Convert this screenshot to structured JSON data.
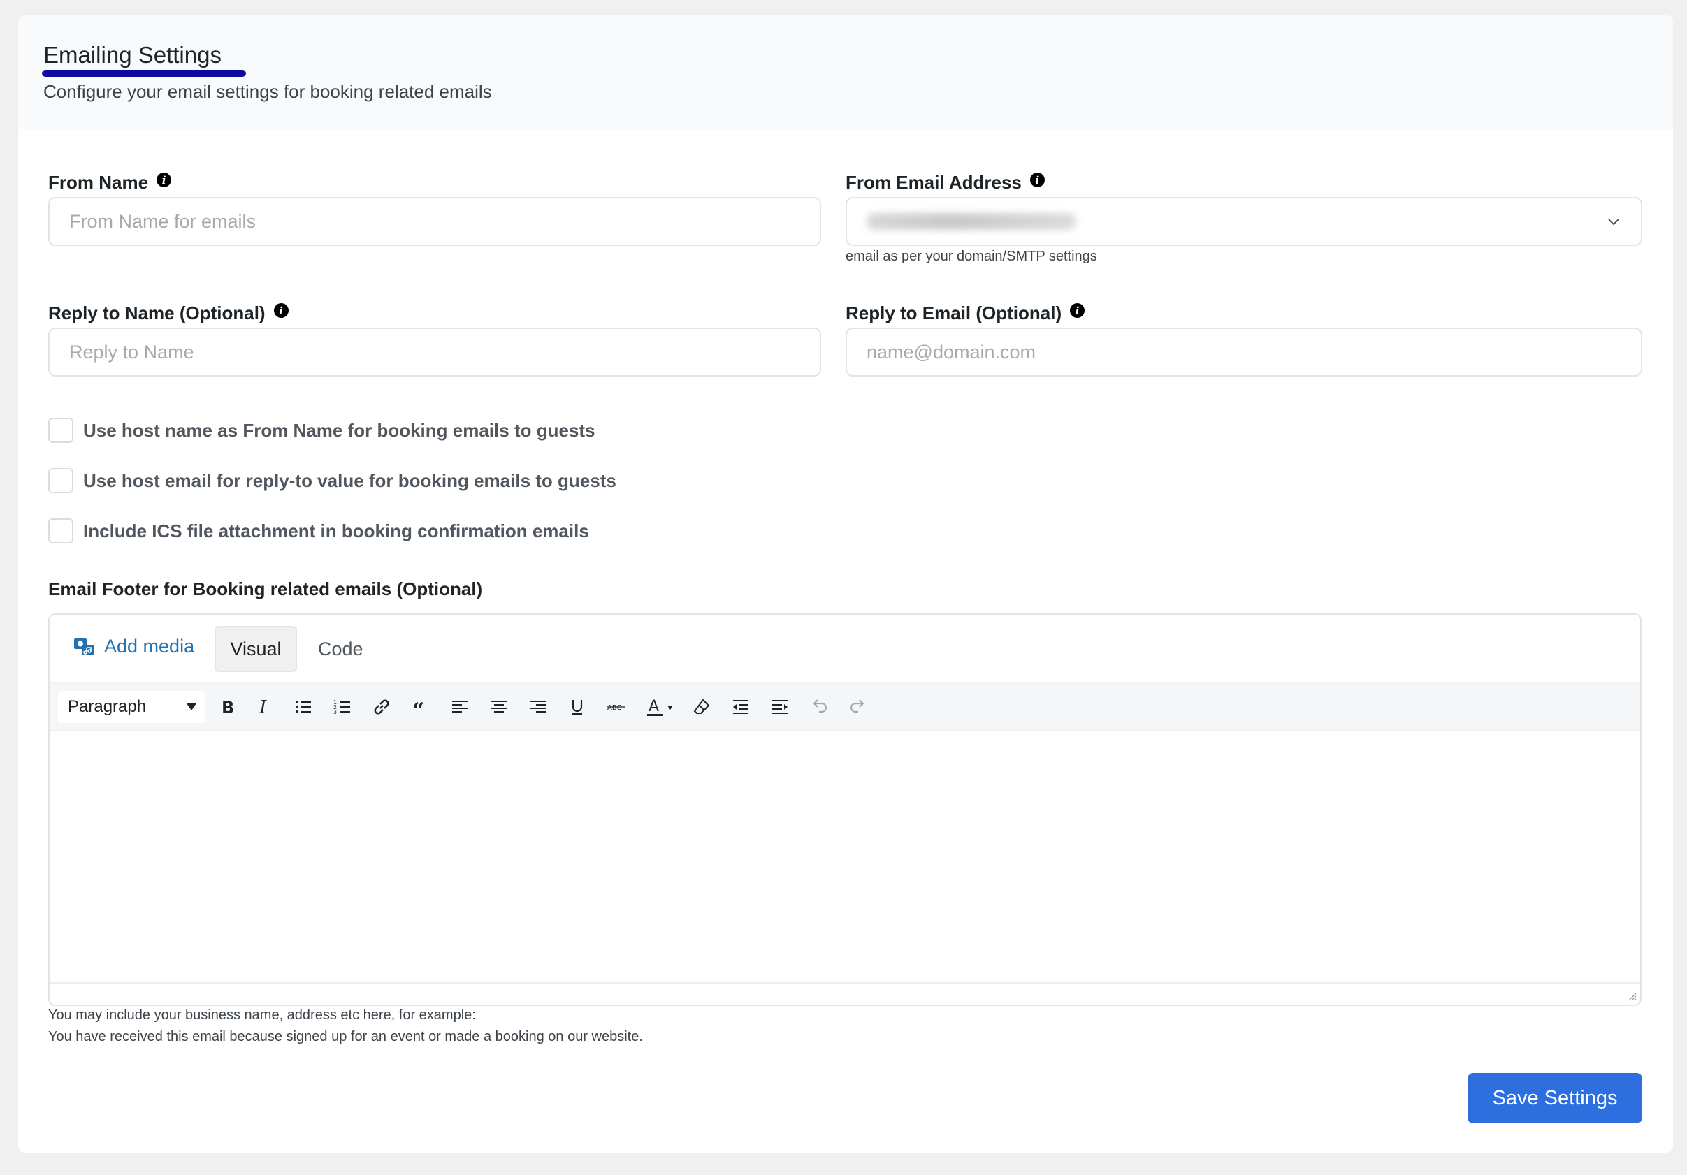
{
  "header": {
    "title": "Emailing Settings",
    "subtitle": "Configure your email settings for booking related emails"
  },
  "fields": {
    "from_name": {
      "label": "From Name",
      "placeholder": "From Name for emails",
      "value": ""
    },
    "from_email": {
      "label": "From Email Address",
      "helper": "email as per your domain/SMTP settings"
    },
    "reply_to_name": {
      "label": "Reply to Name (Optional)",
      "placeholder": "Reply to Name",
      "value": ""
    },
    "reply_to_email": {
      "label": "Reply to Email (Optional)",
      "placeholder": "name@domain.com",
      "value": ""
    }
  },
  "checkboxes": [
    {
      "label": "Use host name as From Name for booking emails to guests",
      "checked": false
    },
    {
      "label": "Use host email for reply-to value for booking emails to guests",
      "checked": false
    },
    {
      "label": "Include ICS file attachment in booking confirmation emails",
      "checked": false
    }
  ],
  "footer_editor": {
    "label": "Email Footer for Booking related emails (Optional)",
    "add_media": "Add media",
    "tabs": [
      "Visual",
      "Code"
    ],
    "active_tab": "Visual",
    "format": "Paragraph",
    "toolbar_icons": [
      "bold-icon",
      "italic-icon",
      "bullet-list-icon",
      "numbered-list-icon",
      "link-icon",
      "blockquote-icon",
      "align-left-icon",
      "align-center-icon",
      "align-right-icon",
      "underline-icon",
      "strikethrough-icon",
      "text-color-icon",
      "clear-formatting-icon",
      "outdent-icon",
      "indent-icon",
      "undo-icon",
      "redo-icon"
    ],
    "hint_line1": "You may include your business name, address etc here, for example:",
    "hint_line2": "You have received this email because signed up for an event or made a booking on our website."
  },
  "actions": {
    "save_label": "Save Settings"
  },
  "colors": {
    "accent": "#2e6fe0",
    "link": "#2271b1",
    "title_underline": "#0b0ba0"
  }
}
